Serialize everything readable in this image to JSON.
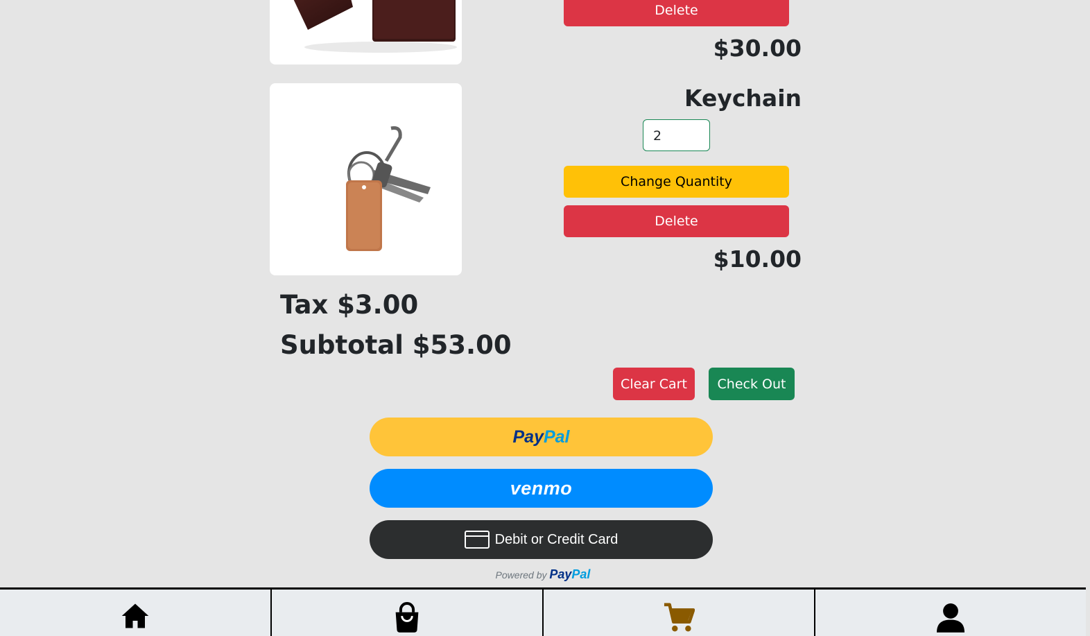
{
  "items": [
    {
      "name": "",
      "price": "$30.00",
      "delete_label": "Delete",
      "image_icon": "wallet-icon"
    },
    {
      "name": "Keychain",
      "quantity": "2",
      "change_label": "Change Quantity",
      "delete_label": "Delete",
      "price": "$10.00",
      "image_icon": "keychain-icon"
    }
  ],
  "totals": {
    "tax": "Tax $3.00",
    "subtotal": "Subtotal $53.00"
  },
  "actions": {
    "clear_cart": "Clear Cart",
    "check_out": "Check Out"
  },
  "payment": {
    "paypal_a": "Pay",
    "paypal_b": "Pal",
    "venmo": "venmo",
    "card": "Debit or Credit Card",
    "powered_by": "Powered by",
    "powered_a": "Pay",
    "powered_b": "Pal"
  },
  "nav": [
    "home-icon",
    "shopping-bag-icon",
    "cart-icon",
    "user-icon"
  ],
  "colors": {
    "danger": "#dc3545",
    "warning": "#ffc107",
    "success": "#198754",
    "paypal": "#ffc439",
    "venmo": "#008cff",
    "active_nav": "#8a5a00"
  }
}
